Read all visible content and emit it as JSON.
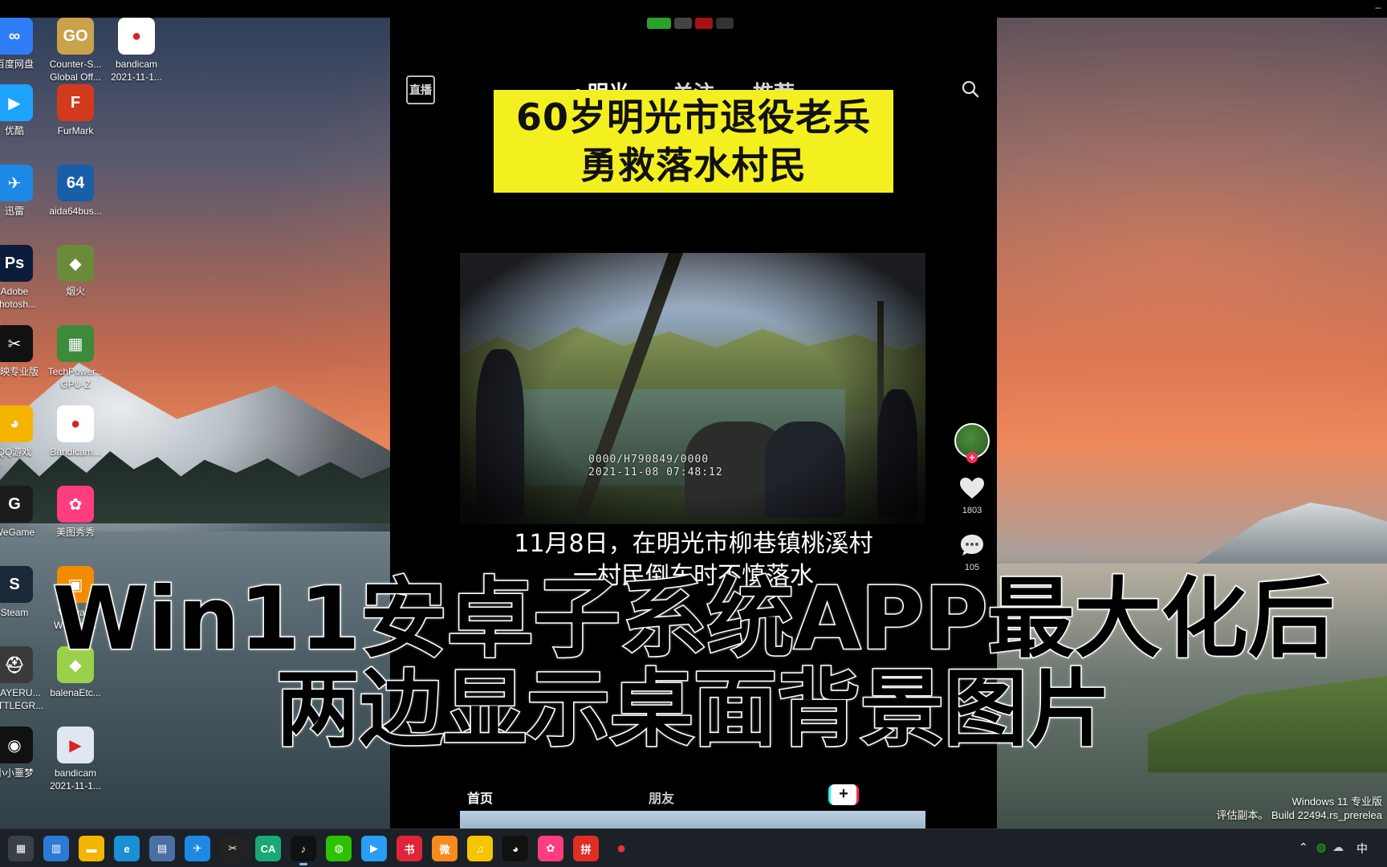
{
  "window": {
    "minimize_label": "–"
  },
  "desktop_icons": [
    {
      "label": "百度网盘",
      "color": "#2f7df6",
      "glyph": "∞"
    },
    {
      "label": "Counter-S...\nGlobal Off...",
      "color": "#c9a24a",
      "glyph": "GO"
    },
    {
      "label": "bandicam\n2021-11-1...",
      "color": "#ffffff",
      "glyph": "●"
    },
    {
      "label": "优酷",
      "color": "#1ea3ff",
      "glyph": "▶"
    },
    {
      "label": "FurMark",
      "color": "#d23a1d",
      "glyph": "F"
    },
    {
      "label": "迅雷",
      "color": "#1e88e5",
      "glyph": "✈"
    },
    {
      "label": "aida64bus...",
      "color": "#1a5ea8",
      "glyph": "64"
    },
    {
      "label": "Adobe\nPhotosh...",
      "color": "#0b1d3a",
      "glyph": "Ps"
    },
    {
      "label": "烟火",
      "color": "#6b8a3a",
      "glyph": "◆"
    },
    {
      "label": "剪映专业版",
      "color": "#111111",
      "glyph": "✂"
    },
    {
      "label": "TechPower...\nGPU-Z",
      "color": "#3c8a3c",
      "glyph": "▦"
    },
    {
      "label": "QQ游戏",
      "color": "#f4b400",
      "glyph": "◕"
    },
    {
      "label": "Bandicam...",
      "color": "#ffffff",
      "glyph": "●"
    },
    {
      "label": "WeGame",
      "color": "#1c1c1c",
      "glyph": "G"
    },
    {
      "label": "美图秀秀",
      "color": "#ff3d7f",
      "glyph": "✿"
    },
    {
      "label": "Steam",
      "color": "#1b2838",
      "glyph": "S"
    },
    {
      "label": "VMwa...\nWorksta...",
      "color": "#f38b00",
      "glyph": "▣"
    },
    {
      "label": "PLAYERU...\nBATTLEGR...",
      "color": "#3a3a3a",
      "glyph": "⛑"
    },
    {
      "label": "balenaEtc...",
      "color": "#9bd14a",
      "glyph": "◆"
    },
    {
      "label": "小小噩梦",
      "color": "#111111",
      "glyph": "◉"
    },
    {
      "label": "bandicam\n2021-11-1...",
      "color": "#dfe8f2",
      "glyph": "▶"
    }
  ],
  "app": {
    "live_label": "直播",
    "location_tab": "明光",
    "follow_tab": "关注",
    "recommend_tab": "推荐",
    "headline_line1": "60岁明光市退役老兵",
    "headline_line2": "勇救落水村民",
    "video_stamp_line1": "0000/H790849/0000",
    "video_stamp_line2": "2021-11-08 07:48:12",
    "caption_line1": "11月8日，在明光市柳巷镇桃溪村",
    "caption_line2": "一村民倒车时不慎落水",
    "like_count": "1803",
    "comment_count": "105",
    "bottom_tab_home": "首页",
    "bottom_tab_friends": "朋友",
    "plus_label": "+"
  },
  "overlay": {
    "line1": "Win11安卓子系统APP最大化后",
    "line2": "两边显示桌面背景图片"
  },
  "watermark": {
    "line1": "Windows 11 专业版",
    "line2": "评估副本。 Build 22494.rs_prerelea"
  },
  "taskbar": {
    "tray_ime": "中",
    "apps": [
      {
        "name": "start",
        "color": "#3a4048",
        "glyph": "▦"
      },
      {
        "name": "widgets",
        "color": "#2d7ad6",
        "glyph": "▥"
      },
      {
        "name": "explorer",
        "color": "#f2b600",
        "glyph": "▬"
      },
      {
        "name": "edge",
        "color": "#1a8fd3",
        "glyph": "e"
      },
      {
        "name": "store",
        "color": "#4a6fa5",
        "glyph": "▤"
      },
      {
        "name": "xunlei",
        "color": "#1e88e5",
        "glyph": "✈"
      },
      {
        "name": "capcut",
        "color": "#222222",
        "glyph": "✂"
      },
      {
        "name": "aicode",
        "color": "#19a974",
        "glyph": "CA"
      },
      {
        "name": "tiktok",
        "color": "#111111",
        "glyph": "♪"
      },
      {
        "name": "wechat",
        "color": "#2dc100",
        "glyph": "◍"
      },
      {
        "name": "player",
        "color": "#2a9df4",
        "glyph": "▶"
      },
      {
        "name": "xiaohongshu",
        "color": "#e0243a",
        "glyph": "书"
      },
      {
        "name": "weibo",
        "color": "#f58a1f",
        "glyph": "微"
      },
      {
        "name": "music",
        "color": "#f7c400",
        "glyph": "♫"
      },
      {
        "name": "qq",
        "color": "#111111",
        "glyph": "◕"
      },
      {
        "name": "meitu",
        "color": "#ff3d7f",
        "glyph": "✿"
      },
      {
        "name": "pdd",
        "color": "#e02e24",
        "glyph": "拼"
      },
      {
        "name": "record",
        "color": "#1c2128",
        "glyph": "●"
      }
    ]
  }
}
